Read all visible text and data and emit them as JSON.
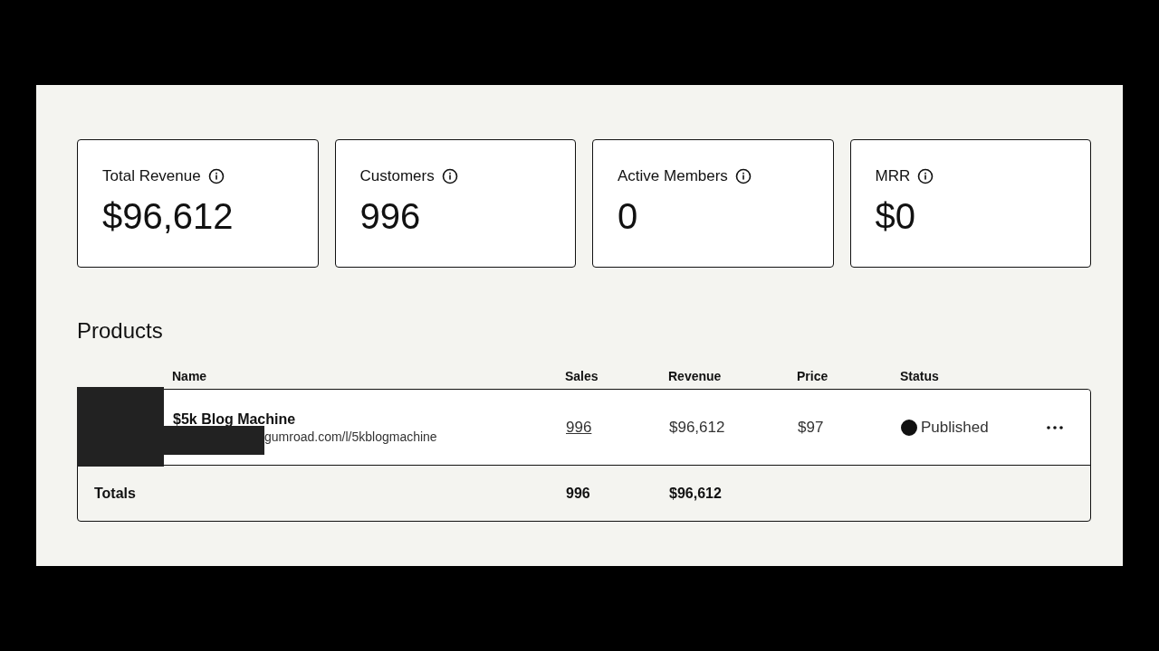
{
  "stats": [
    {
      "label": "Total Revenue",
      "value": "$96,612"
    },
    {
      "label": "Customers",
      "value": "996"
    },
    {
      "label": "Active Members",
      "value": "0"
    },
    {
      "label": "MRR",
      "value": "$0"
    }
  ],
  "products": {
    "title": "Products",
    "columns": [
      "Name",
      "Sales",
      "Revenue",
      "Price",
      "Status"
    ],
    "rows": [
      {
        "name": "$5k Blog Machine",
        "url": "gumroad.com/l/5kblogmachine",
        "sales": "996",
        "revenue": "$96,612",
        "price": "$97",
        "status": "Published",
        "published": true
      }
    ],
    "totals": {
      "label": "Totals",
      "sales": "996",
      "revenue": "$96,612"
    }
  }
}
